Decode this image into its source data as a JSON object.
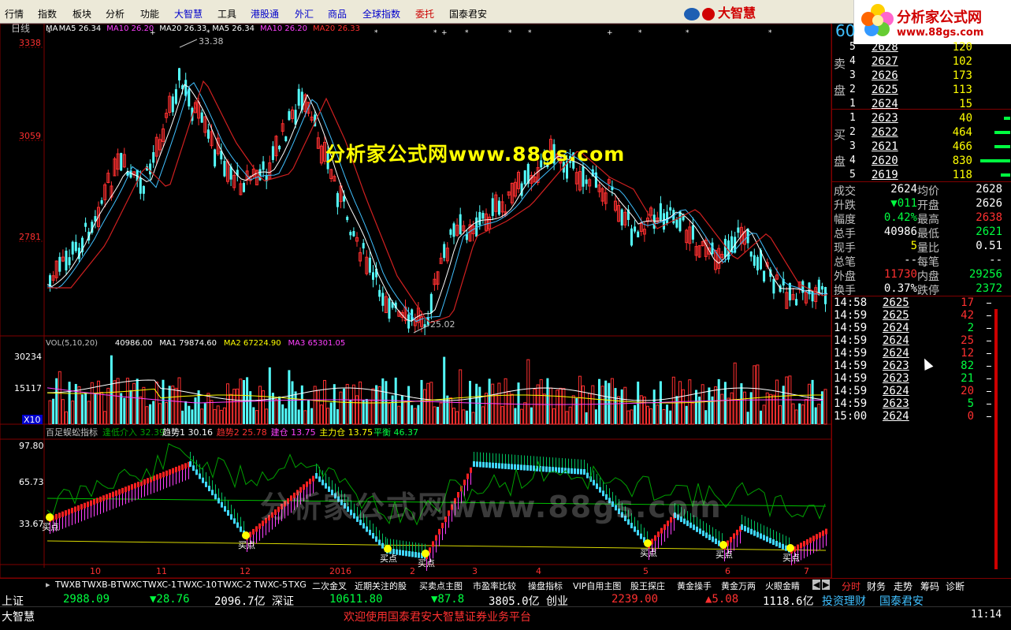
{
  "menu": [
    "行情",
    "指数",
    "板块",
    "分析",
    "功能",
    "大智慧",
    "工具",
    "港股通",
    "外汇",
    "商品",
    "全球指数",
    "委托",
    "国泰君安"
  ],
  "menu_colors": [
    "#000000",
    "#000000",
    "#000000",
    "#000000",
    "#000000",
    "#0000cc",
    "#000000",
    "#0000cc",
    "#0000cc",
    "#0000cc",
    "#0000cc",
    "#cc0000",
    "#000000"
  ],
  "logo_text": "大智慧",
  "corner": {
    "title": "分析家公式网",
    "url": "www.88gs.com"
  },
  "chart": {
    "period": "日线",
    "ma_legend": [
      {
        "label": "MA",
        "value": "",
        "color": "#ffffff"
      },
      {
        "label": "MA5",
        "value": "26.34",
        "color": "#ffffff"
      },
      {
        "label": "MA10",
        "value": "26.20",
        "color": "#ff40ff"
      },
      {
        "label": "MA20",
        "value": "26.33",
        "color": "#ffffff"
      },
      {
        "label": "MA5",
        "value": "26.34",
        "color": "#ffffff"
      },
      {
        "label": "MA10",
        "value": "26.20",
        "color": "#ff40ff"
      },
      {
        "label": "MA20",
        "value": "26.33",
        "color": "#ff3030"
      }
    ],
    "price_axis": [
      "3338",
      "3059",
      "2781"
    ],
    "high_label": "33.38",
    "low_label": "25.02",
    "watermark": "分析家公式网www.88gs.com",
    "watermark2": "分析家公式网www.88gs.com",
    "vol_legend": [
      {
        "label": "VOL(5,10,20)",
        "value": "",
        "color": "#c0c0c0"
      },
      {
        "label": "",
        "value": "40986.00",
        "color": "#ffffff"
      },
      {
        "label": "MA1",
        "value": "79874.60",
        "color": "#ffffff"
      },
      {
        "label": "MA2",
        "value": "67224.90",
        "color": "#ffff00"
      },
      {
        "label": "MA3",
        "value": "65301.05",
        "color": "#ff40ff"
      }
    ],
    "vol_axis": [
      "30234",
      "15117"
    ],
    "vol_unit": "X10",
    "ind_name": "百足蜈蚣指标",
    "ind_legend": [
      {
        "label": "逢低介入",
        "value": "32.39",
        "color": "#00a000"
      },
      {
        "label": "趋势1",
        "value": "30.16",
        "color": "#ffffff"
      },
      {
        "label": "趋势2",
        "value": "25.78",
        "color": "#ff3030"
      },
      {
        "label": "建仓",
        "value": "13.75",
        "color": "#ff40ff"
      },
      {
        "label": "主力仓",
        "value": "13.75",
        "color": "#ffff00"
      },
      {
        "label": "平衡",
        "value": "46.37",
        "color": "#00ff40"
      }
    ],
    "ind_axis": [
      "97.80",
      "65.73",
      "33.67"
    ],
    "buy_label": "买点",
    "x_axis": [
      "10",
      "11",
      "12",
      "2016",
      "2",
      "3",
      "4",
      "5",
      "6",
      "7"
    ]
  },
  "quote": {
    "code_partial": "60",
    "sell_label": [
      "卖",
      "盘"
    ],
    "buy_label": [
      "买",
      "盘"
    ],
    "asks": [
      {
        "lvl": "5",
        "price": "2628",
        "vol": "120"
      },
      {
        "lvl": "4",
        "price": "2627",
        "vol": "102"
      },
      {
        "lvl": "3",
        "price": "2626",
        "vol": "173"
      },
      {
        "lvl": "2",
        "price": "2625",
        "vol": "113"
      },
      {
        "lvl": "1",
        "price": "2624",
        "vol": "15"
      }
    ],
    "bids": [
      {
        "lvl": "1",
        "price": "2623",
        "vol": "40"
      },
      {
        "lvl": "2",
        "price": "2622",
        "vol": "464"
      },
      {
        "lvl": "3",
        "price": "2621",
        "vol": "466"
      },
      {
        "lvl": "4",
        "price": "2620",
        "vol": "830"
      },
      {
        "lvl": "5",
        "price": "2619",
        "vol": "118"
      }
    ],
    "stats": [
      {
        "l1": "成交",
        "v1": "2624",
        "c1": "#ffffff",
        "l2": "均价",
        "v2": "2628",
        "c2": "#ffffff"
      },
      {
        "l1": "升跌",
        "v1": "▼011",
        "c1": "#00ff40",
        "l2": "开盘",
        "v2": "2626",
        "c2": "#ffffff"
      },
      {
        "l1": "幅度",
        "v1": "0.42%",
        "c1": "#00ff40",
        "l2": "最高",
        "v2": "2638",
        "c2": "#ff3030"
      },
      {
        "l1": "总手",
        "v1": "40986",
        "c1": "#ffffff",
        "l2": "最低",
        "v2": "2621",
        "c2": "#00ff40"
      },
      {
        "l1": "现手",
        "v1": "5",
        "c1": "#ffff00",
        "l2": "量比",
        "v2": "0.51",
        "c2": "#ffffff"
      },
      {
        "l1": "总笔",
        "v1": "--",
        "c1": "#ffffff",
        "l2": "每笔",
        "v2": "--",
        "c2": "#ffffff"
      },
      {
        "l1": "外盘",
        "v1": "11730",
        "c1": "#ff3030",
        "l2": "内盘",
        "v2": "29256",
        "c2": "#00ff40"
      },
      {
        "l1": "换手",
        "v1": "0.37%",
        "c1": "#ffffff",
        "l2": "跌停",
        "v2": "2372",
        "c2": "#00ff40"
      }
    ],
    "ticks": [
      {
        "time": "14:58",
        "price": "2625",
        "vol": "17",
        "vc": "#ff3030"
      },
      {
        "time": "14:59",
        "price": "2625",
        "vol": "42",
        "vc": "#ff3030"
      },
      {
        "time": "14:59",
        "price": "2624",
        "vol": "2",
        "vc": "#00ff40"
      },
      {
        "time": "14:59",
        "price": "2624",
        "vol": "25",
        "vc": "#ff3030"
      },
      {
        "time": "14:59",
        "price": "2624",
        "vol": "12",
        "vc": "#ff3030"
      },
      {
        "time": "14:59",
        "price": "2623",
        "vol": "82",
        "vc": "#00ff40"
      },
      {
        "time": "14:59",
        "price": "2623",
        "vol": "21",
        "vc": "#00ff40"
      },
      {
        "time": "14:59",
        "price": "2624",
        "vol": "20",
        "vc": "#ff3030"
      },
      {
        "time": "14:59",
        "price": "2623",
        "vol": "5",
        "vc": "#00ff40"
      },
      {
        "time": "15:00",
        "price": "2624",
        "vol": "0",
        "vc": "#ff3030"
      }
    ]
  },
  "tabs": [
    "TWXB",
    "TWXB-B",
    "TWXC",
    "TWXC-1",
    "TWXC-10",
    "TWXC-2",
    "TWXC-5",
    "TXG",
    "二次金叉",
    "近期关注的股",
    "买卖点主图",
    "市盈率比较",
    "操盘指标",
    "VIP自用主图",
    "股王探庄",
    "黄金操手",
    "黄金万两",
    "火眼金睛"
  ],
  "right_tabs": [
    "分时",
    "财务",
    "走势",
    "筹码",
    "诊断"
  ],
  "status": {
    "sh_label": "上证",
    "sh_index": "2988.09",
    "sh_chg": "▼28.76",
    "sh_amt": "2096.7亿",
    "sz_label": "深证",
    "sz_index": "10611.80",
    "sz_chg": "▼87.8",
    "sz_amt": "3805.0亿",
    "cy_label": "创业",
    "cy_index": "2239.00",
    "cy_chg": "▲5.08",
    "cy_amt": "1118.6亿",
    "t1": "投资理财",
    "t2": "国泰君安",
    "app_name": "大智慧",
    "welcome": "欢迎使用国泰君安大智慧证券业务平台",
    "clock": "11:14"
  }
}
